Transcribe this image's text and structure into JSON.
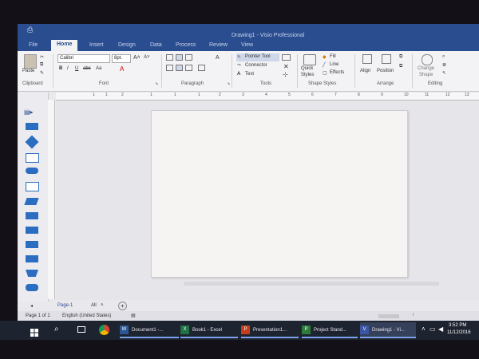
{
  "window": {
    "title": "Drawing1 - Visio Professional",
    "quick_access": "⎙"
  },
  "tabs": [
    "File",
    "Home",
    "Insert",
    "Design",
    "Data",
    "Process",
    "Review",
    "View"
  ],
  "ribbon": {
    "clipboard": {
      "paste": "Paste",
      "label": "Clipboard"
    },
    "font": {
      "name": "Calibri",
      "size": "8pt.",
      "label": "Font",
      "bold": "B",
      "italic": "I",
      "underline": "U",
      "strike": "abc",
      "case": "Aa",
      "color_a": "A"
    },
    "paragraph": {
      "label": "Paragraph"
    },
    "tools": {
      "pointer": "Pointer Tool",
      "connector": "Connector",
      "text": "Text",
      "label": "Tools"
    },
    "shape_styles": {
      "quick": "Quick",
      "styles": "Styles",
      "fill": "Fill",
      "line": "Line",
      "effects": "Effects",
      "label": "Shape Styles"
    },
    "arrange": {
      "align": "Align",
      "position": "Position",
      "label": "Arrange"
    },
    "editing": {
      "change": "Change",
      "shape": "Shape",
      "label": "Editing"
    }
  },
  "ruler": {
    "ticks": [
      "1",
      "1",
      "2",
      "1",
      "1",
      "1",
      "2",
      "3",
      "4",
      "5",
      "6",
      "7",
      "8",
      "9",
      "10",
      "11",
      "12",
      "13"
    ]
  },
  "page_tabs": {
    "page": "Page-1",
    "all": "All",
    "add": "+"
  },
  "status": {
    "page": "Page 1 of 1",
    "language": "English (United States)"
  },
  "taskbar": {
    "items": [
      {
        "label": "Document1 -...",
        "app": "W",
        "color": "#2b5797"
      },
      {
        "label": "Book1 - Excel",
        "app": "X",
        "color": "#207245"
      },
      {
        "label": "Presentation1...",
        "app": "P",
        "color": "#c43e1c"
      },
      {
        "label": "Project Stand...",
        "app": "P",
        "color": "#2d7d3a"
      },
      {
        "label": "Drawing1 - Vi...",
        "app": "V",
        "color": "#3955a3"
      }
    ],
    "time": "3:52 PM",
    "date": "11/12/2016"
  },
  "colors": {
    "accent": "#2a4d8f",
    "shape_blue": "#2b6dc1"
  }
}
